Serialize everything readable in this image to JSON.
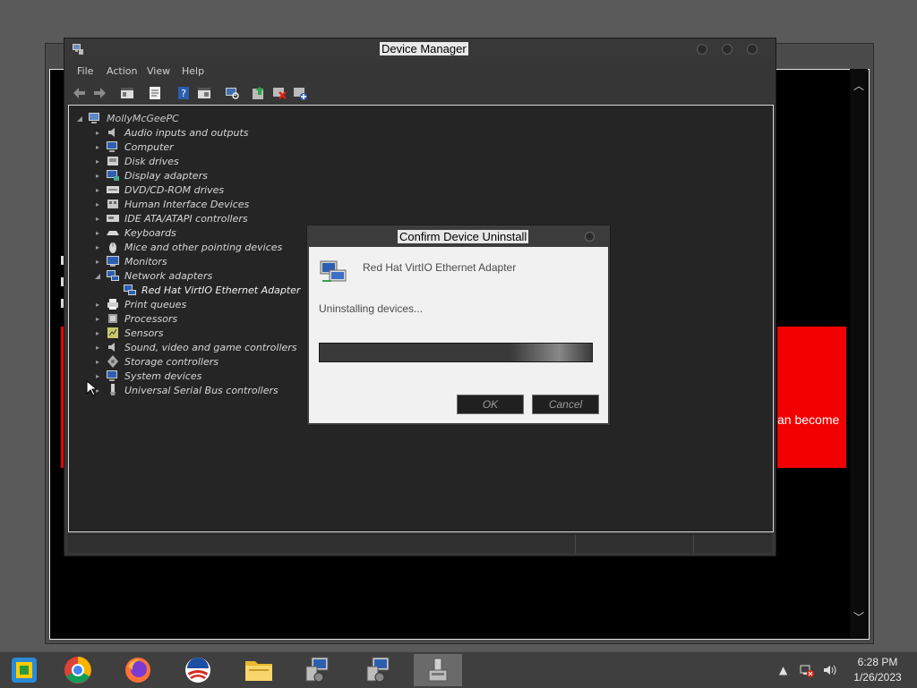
{
  "device_manager": {
    "title": "Device Manager",
    "menu": [
      "File",
      "Action",
      "View",
      "Help"
    ],
    "toolbar_icons": [
      "back-arrow-icon",
      "forward-arrow-icon",
      "console-tree-icon",
      "properties-icon",
      "help-icon",
      "view-icon",
      "scan-hardware-icon",
      "update-driver-icon",
      "uninstall-device-icon",
      "add-legacy-icon"
    ],
    "tree": {
      "root": "MollyMcGeePC",
      "items": [
        {
          "label": "Audio inputs and outputs",
          "icon": "speaker-icon"
        },
        {
          "label": "Computer",
          "icon": "computer-icon"
        },
        {
          "label": "Disk drives",
          "icon": "disk-icon"
        },
        {
          "label": "Display adapters",
          "icon": "display-adapter-icon"
        },
        {
          "label": "DVD/CD-ROM drives",
          "icon": "dvd-icon"
        },
        {
          "label": "Human Interface Devices",
          "icon": "hid-icon"
        },
        {
          "label": "IDE ATA/ATAPI controllers",
          "icon": "ide-icon"
        },
        {
          "label": "Keyboards",
          "icon": "keyboard-icon"
        },
        {
          "label": "Mice and other pointing devices",
          "icon": "mouse-icon"
        },
        {
          "label": "Monitors",
          "icon": "monitor-icon"
        },
        {
          "label": "Network adapters",
          "icon": "network-icon",
          "expanded": true
        },
        {
          "label": "Red Hat VirtIO Ethernet Adapter",
          "icon": "network-icon",
          "child": true
        },
        {
          "label": "Print queues",
          "icon": "printer-icon"
        },
        {
          "label": "Processors",
          "icon": "processor-icon"
        },
        {
          "label": "Sensors",
          "icon": "sensor-icon"
        },
        {
          "label": "Sound, video and game controllers",
          "icon": "speaker-icon"
        },
        {
          "label": "Storage controllers",
          "icon": "storage-icon"
        },
        {
          "label": "System devices",
          "icon": "system-icon"
        },
        {
          "label": "Universal Serial Bus controllers",
          "icon": "usb-icon"
        }
      ]
    }
  },
  "dialog": {
    "title": "Confirm Device Uninstall",
    "device_name": "Red Hat VirtIO Ethernet Adapter",
    "message": "Uninstalling devices...",
    "progress_fraction": 1.0,
    "ok_label": "OK",
    "cancel_label": "Cancel"
  },
  "background_window": {
    "visible_text": "an become"
  },
  "taskbar": {
    "apps": [
      "start-orb-icon",
      "chrome-icon",
      "firefox-icon",
      "obama-logo-icon",
      "file-explorer-icon",
      "device-manager-icon",
      "device-manager-icon",
      "uninstall-icon"
    ],
    "tray_icons": [
      "show-hidden-icon",
      "network-error-icon",
      "volume-icon"
    ],
    "time": "6:28 PM",
    "date": "1/26/2023"
  },
  "colors": {
    "red_panel": "#f20000",
    "window_dark": "#363636"
  }
}
